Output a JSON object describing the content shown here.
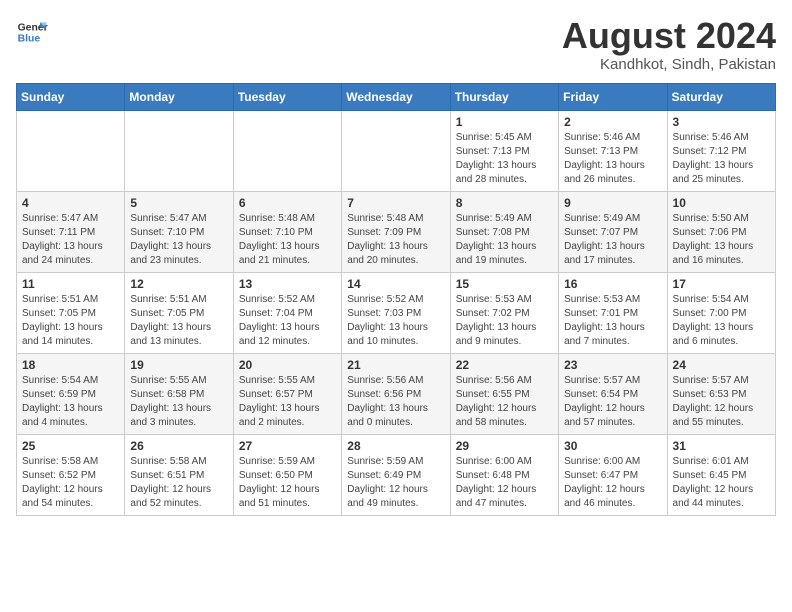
{
  "header": {
    "logo_line1": "General",
    "logo_line2": "Blue",
    "month_year": "August 2024",
    "location": "Kandhkot, Sindh, Pakistan"
  },
  "days_of_week": [
    "Sunday",
    "Monday",
    "Tuesday",
    "Wednesday",
    "Thursday",
    "Friday",
    "Saturday"
  ],
  "weeks": [
    [
      {
        "day": "",
        "info": ""
      },
      {
        "day": "",
        "info": ""
      },
      {
        "day": "",
        "info": ""
      },
      {
        "day": "",
        "info": ""
      },
      {
        "day": "1",
        "info": "Sunrise: 5:45 AM\nSunset: 7:13 PM\nDaylight: 13 hours\nand 28 minutes."
      },
      {
        "day": "2",
        "info": "Sunrise: 5:46 AM\nSunset: 7:13 PM\nDaylight: 13 hours\nand 26 minutes."
      },
      {
        "day": "3",
        "info": "Sunrise: 5:46 AM\nSunset: 7:12 PM\nDaylight: 13 hours\nand 25 minutes."
      }
    ],
    [
      {
        "day": "4",
        "info": "Sunrise: 5:47 AM\nSunset: 7:11 PM\nDaylight: 13 hours\nand 24 minutes."
      },
      {
        "day": "5",
        "info": "Sunrise: 5:47 AM\nSunset: 7:10 PM\nDaylight: 13 hours\nand 23 minutes."
      },
      {
        "day": "6",
        "info": "Sunrise: 5:48 AM\nSunset: 7:10 PM\nDaylight: 13 hours\nand 21 minutes."
      },
      {
        "day": "7",
        "info": "Sunrise: 5:48 AM\nSunset: 7:09 PM\nDaylight: 13 hours\nand 20 minutes."
      },
      {
        "day": "8",
        "info": "Sunrise: 5:49 AM\nSunset: 7:08 PM\nDaylight: 13 hours\nand 19 minutes."
      },
      {
        "day": "9",
        "info": "Sunrise: 5:49 AM\nSunset: 7:07 PM\nDaylight: 13 hours\nand 17 minutes."
      },
      {
        "day": "10",
        "info": "Sunrise: 5:50 AM\nSunset: 7:06 PM\nDaylight: 13 hours\nand 16 minutes."
      }
    ],
    [
      {
        "day": "11",
        "info": "Sunrise: 5:51 AM\nSunset: 7:05 PM\nDaylight: 13 hours\nand 14 minutes."
      },
      {
        "day": "12",
        "info": "Sunrise: 5:51 AM\nSunset: 7:05 PM\nDaylight: 13 hours\nand 13 minutes."
      },
      {
        "day": "13",
        "info": "Sunrise: 5:52 AM\nSunset: 7:04 PM\nDaylight: 13 hours\nand 12 minutes."
      },
      {
        "day": "14",
        "info": "Sunrise: 5:52 AM\nSunset: 7:03 PM\nDaylight: 13 hours\nand 10 minutes."
      },
      {
        "day": "15",
        "info": "Sunrise: 5:53 AM\nSunset: 7:02 PM\nDaylight: 13 hours\nand 9 minutes."
      },
      {
        "day": "16",
        "info": "Sunrise: 5:53 AM\nSunset: 7:01 PM\nDaylight: 13 hours\nand 7 minutes."
      },
      {
        "day": "17",
        "info": "Sunrise: 5:54 AM\nSunset: 7:00 PM\nDaylight: 13 hours\nand 6 minutes."
      }
    ],
    [
      {
        "day": "18",
        "info": "Sunrise: 5:54 AM\nSunset: 6:59 PM\nDaylight: 13 hours\nand 4 minutes."
      },
      {
        "day": "19",
        "info": "Sunrise: 5:55 AM\nSunset: 6:58 PM\nDaylight: 13 hours\nand 3 minutes."
      },
      {
        "day": "20",
        "info": "Sunrise: 5:55 AM\nSunset: 6:57 PM\nDaylight: 13 hours\nand 2 minutes."
      },
      {
        "day": "21",
        "info": "Sunrise: 5:56 AM\nSunset: 6:56 PM\nDaylight: 13 hours\nand 0 minutes."
      },
      {
        "day": "22",
        "info": "Sunrise: 5:56 AM\nSunset: 6:55 PM\nDaylight: 12 hours\nand 58 minutes."
      },
      {
        "day": "23",
        "info": "Sunrise: 5:57 AM\nSunset: 6:54 PM\nDaylight: 12 hours\nand 57 minutes."
      },
      {
        "day": "24",
        "info": "Sunrise: 5:57 AM\nSunset: 6:53 PM\nDaylight: 12 hours\nand 55 minutes."
      }
    ],
    [
      {
        "day": "25",
        "info": "Sunrise: 5:58 AM\nSunset: 6:52 PM\nDaylight: 12 hours\nand 54 minutes."
      },
      {
        "day": "26",
        "info": "Sunrise: 5:58 AM\nSunset: 6:51 PM\nDaylight: 12 hours\nand 52 minutes."
      },
      {
        "day": "27",
        "info": "Sunrise: 5:59 AM\nSunset: 6:50 PM\nDaylight: 12 hours\nand 51 minutes."
      },
      {
        "day": "28",
        "info": "Sunrise: 5:59 AM\nSunset: 6:49 PM\nDaylight: 12 hours\nand 49 minutes."
      },
      {
        "day": "29",
        "info": "Sunrise: 6:00 AM\nSunset: 6:48 PM\nDaylight: 12 hours\nand 47 minutes."
      },
      {
        "day": "30",
        "info": "Sunrise: 6:00 AM\nSunset: 6:47 PM\nDaylight: 12 hours\nand 46 minutes."
      },
      {
        "day": "31",
        "info": "Sunrise: 6:01 AM\nSunset: 6:45 PM\nDaylight: 12 hours\nand 44 minutes."
      }
    ]
  ]
}
